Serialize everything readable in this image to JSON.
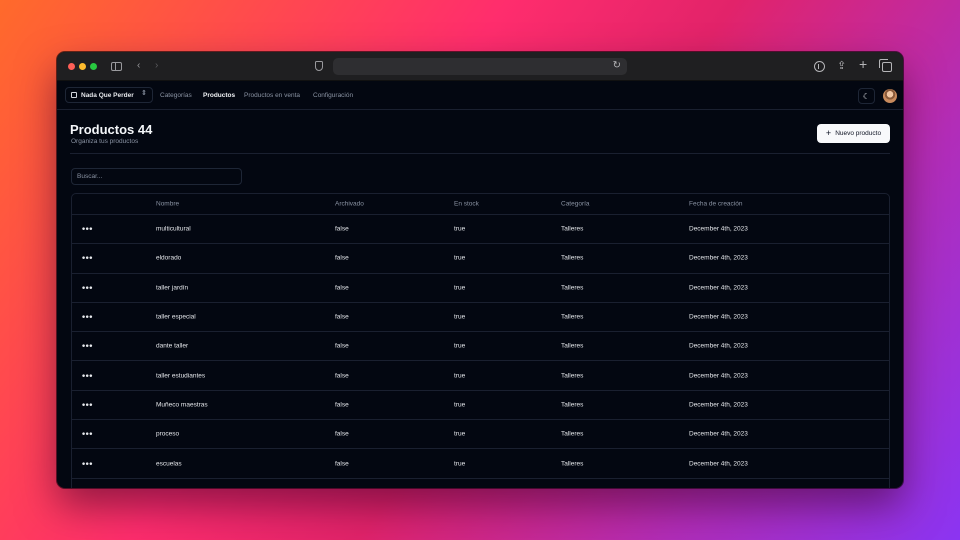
{
  "browser": {
    "url": ""
  },
  "header": {
    "store": "Nada Que Perder",
    "nav": [
      "Categorías",
      "Productos",
      "Productos en venta",
      "Configuración"
    ],
    "active_nav": "Productos"
  },
  "page": {
    "title": "Productos 44",
    "subtitle": "Organiza tus productos",
    "new_button": "Nuevo producto"
  },
  "search": {
    "placeholder": "Buscar...",
    "value": ""
  },
  "table": {
    "columns": [
      "Nombre",
      "Archivado",
      "En stock",
      "Categoría",
      "Fecha de creación"
    ],
    "actions_label": "•••",
    "rows": [
      {
        "nombre": "multicultural",
        "archivado": "false",
        "stock": "true",
        "categoria": "Talleres",
        "fecha": "December 4th, 2023"
      },
      {
        "nombre": "eldorado",
        "archivado": "false",
        "stock": "true",
        "categoria": "Talleres",
        "fecha": "December 4th, 2023"
      },
      {
        "nombre": "taller jardín",
        "archivado": "false",
        "stock": "true",
        "categoria": "Talleres",
        "fecha": "December 4th, 2023"
      },
      {
        "nombre": "taller especial",
        "archivado": "false",
        "stock": "true",
        "categoria": "Talleres",
        "fecha": "December 4th, 2023"
      },
      {
        "nombre": "dante taller",
        "archivado": "false",
        "stock": "true",
        "categoria": "Talleres",
        "fecha": "December 4th, 2023"
      },
      {
        "nombre": "taller estudiantes",
        "archivado": "false",
        "stock": "true",
        "categoria": "Talleres",
        "fecha": "December 4th, 2023"
      },
      {
        "nombre": "Muñeco maestras",
        "archivado": "false",
        "stock": "true",
        "categoria": "Talleres",
        "fecha": "December 4th, 2023"
      },
      {
        "nombre": "proceso",
        "archivado": "false",
        "stock": "true",
        "categoria": "Talleres",
        "fecha": "December 4th, 2023"
      },
      {
        "nombre": "escuelas",
        "archivado": "false",
        "stock": "true",
        "categoria": "Talleres",
        "fecha": "December 4th, 2023"
      }
    ]
  },
  "icons": {
    "sidebar": "sidebar-icon",
    "back": "chevron-left-icon",
    "forward": "chevron-right-icon",
    "privacy": "shield-icon",
    "reload": "reload-icon",
    "download": "download-icon",
    "share": "share-icon",
    "new_tab": "plus-icon",
    "tabs": "tabs-overview-icon",
    "theme": "moon-icon",
    "store": "store-icon",
    "switcher": "chevron-up-down-icon"
  },
  "colors": {
    "background": "#030711",
    "border": "#1a2030",
    "muted_text": "#8a93a3",
    "text": "#e6e8ec",
    "button_bg": "#f8f9fb"
  }
}
